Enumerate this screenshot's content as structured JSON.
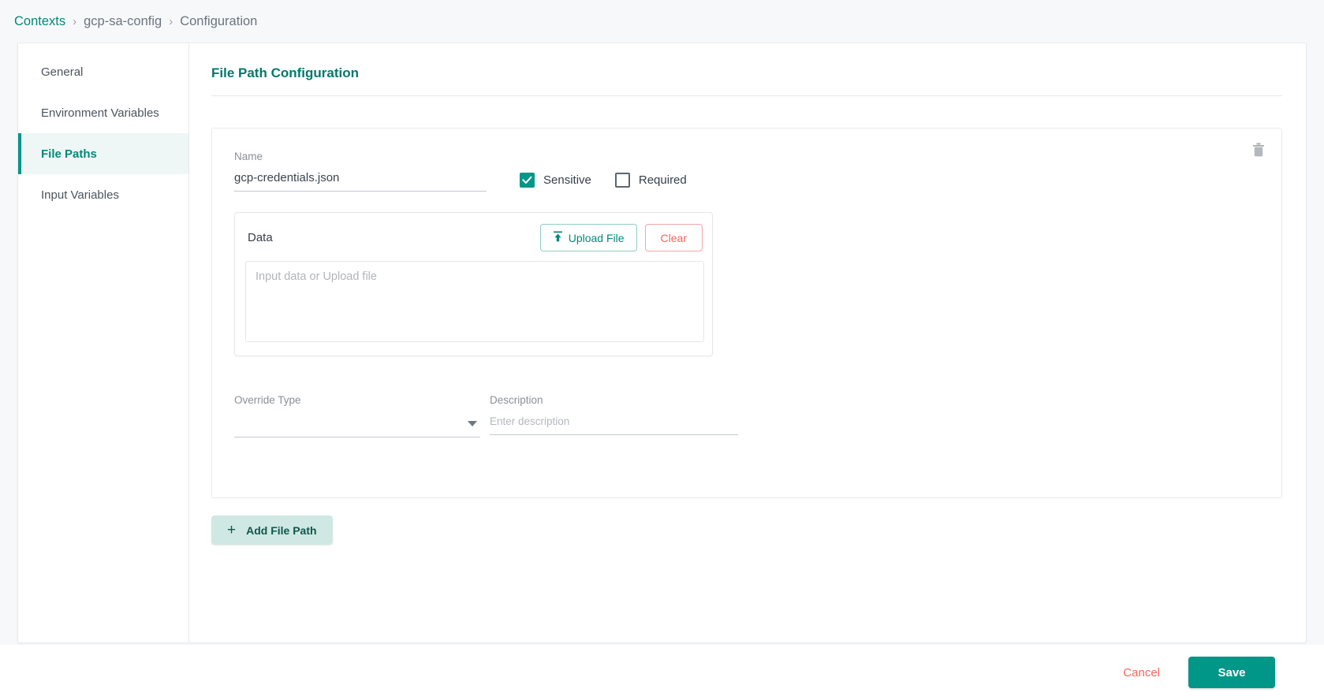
{
  "breadcrumb": {
    "root": "Contexts",
    "context": "gcp-sa-config",
    "current": "Configuration",
    "separator": "›"
  },
  "sidebar": {
    "items": [
      {
        "label": "General",
        "active": false
      },
      {
        "label": "Environment Variables",
        "active": false
      },
      {
        "label": "File Paths",
        "active": true
      },
      {
        "label": "Input Variables",
        "active": false
      }
    ]
  },
  "panel": {
    "title": "File Path Configuration"
  },
  "file_path": {
    "delete_icon": "trash-icon",
    "name_label": "Name",
    "name_value": "gcp-credentials.json",
    "checkboxes": [
      {
        "label": "Sensitive",
        "checked": true
      },
      {
        "label": "Required",
        "checked": false
      }
    ],
    "data_label": "Data",
    "upload_button": "Upload File",
    "upload_icon": "upload-icon",
    "clear_button": "Clear",
    "data_placeholder": "Input data or Upload file",
    "data_value": "",
    "override_label": "Override Type",
    "override_value": "",
    "description_label": "Description",
    "description_value": "",
    "description_placeholder": "Enter description"
  },
  "actions": {
    "add_file_path": "Add File Path",
    "add_icon": "plus-icon"
  },
  "footer": {
    "cancel": "Cancel",
    "save": "Save"
  },
  "colors": {
    "accent_teal": "#009688",
    "accent_teal_dark": "#00796b",
    "danger_red": "#f4675b",
    "page_bg": "#f7f8fa",
    "active_bg": "#eef7f5",
    "add_btn_bg": "#cfe8e3"
  }
}
